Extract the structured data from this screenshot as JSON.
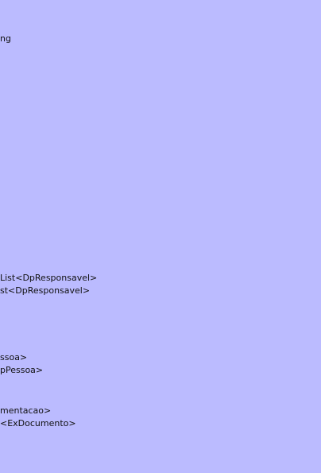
{
  "background_color": "#bbbbff",
  "text_color": "#111111",
  "fragments": [
    "ng",
    "List<DpResponsavel>",
    "st<DpResponsavel>",
    "ssoa>",
    "pPessoa>",
    "mentacao>",
    "<ExDocumento>"
  ]
}
